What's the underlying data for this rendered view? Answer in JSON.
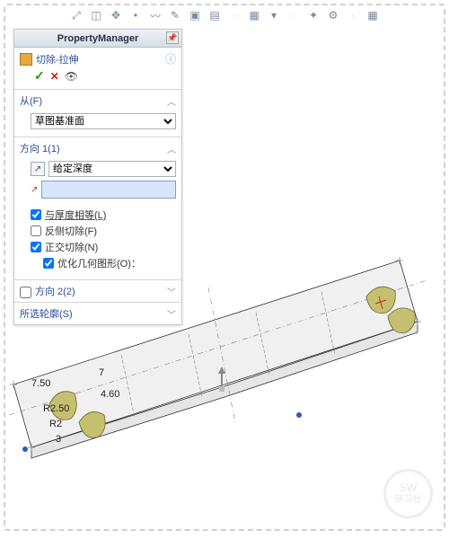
{
  "toolbar": {
    "icons": [
      "axis",
      "plane",
      "coord",
      "point",
      "curve",
      "edit",
      "box1",
      "box2",
      "sep",
      "box3",
      "arrow",
      "sep",
      "compass",
      "measure",
      "sep",
      "grid"
    ]
  },
  "panel": {
    "title": "PropertyManager",
    "feature_name": "切除-拉伸",
    "from": {
      "label": "从(F)",
      "option": "草图基准面"
    },
    "dir1": {
      "label": "方向 1(1)",
      "end_cond": "给定深度",
      "depth_value": "",
      "chk_link_thickness": "与厚度相等(L)",
      "chk_flip": "反侧切除(F)",
      "chk_normal": "正交切除(N)",
      "chk_optimize": "优化几何图形(O)："
    },
    "dir2": {
      "label": "方向 2(2)"
    },
    "contours": {
      "label": "所选轮廓(S)"
    }
  },
  "viewport": {
    "dims": {
      "d1": "7.50",
      "d2": "7",
      "d3": "4.60",
      "d4": "R2.50",
      "d5": "R2",
      "d6": "3"
    }
  },
  "watermark": {
    "l1": "SW",
    "l2": "研习社"
  }
}
